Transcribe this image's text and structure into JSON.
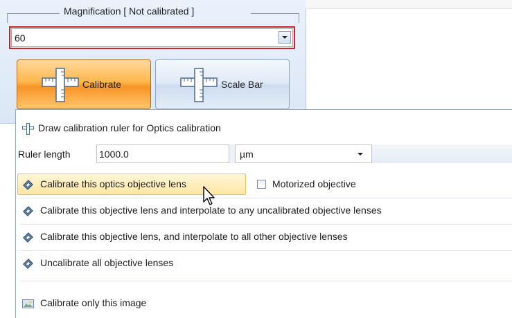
{
  "magnification": {
    "legend": "Magnification [ Not calibrated ]",
    "value": "60"
  },
  "buttons": {
    "calibrate": "Calibrate",
    "scale_bar": "Scale Bar"
  },
  "menu": {
    "draw_ruler": "Draw calibration ruler for Optics calibration",
    "ruler_length_label": "Ruler length",
    "ruler_length_value": "1000.0",
    "unit_value": "µm",
    "calibrate_optics": "Calibrate this optics objective lens",
    "motorized": "Motorized objective",
    "interpolate_uncalibrated": "Calibrate this objective lens and interpolate to any uncalibrated objective lenses",
    "interpolate_all": "Calibrate this objective lens, and interpolate to all other objective lenses",
    "uncalibrate_all": "Uncalibrate all objective lenses",
    "calibrate_image": "Calibrate only this image"
  },
  "icons": {
    "ruler": "ruler-icon",
    "lens": "objective-lens-icon",
    "image": "image-icon",
    "checkbox": "checkbox-unchecked-icon",
    "dropdown": "chevron-down-icon",
    "cursor": "mouse-pointer-icon"
  },
  "colors": {
    "combo_border": "#c1272d",
    "calibrate_active": "#f79427",
    "highlight": "#ffe7a2",
    "panel_bg": "#dbe7f6"
  }
}
